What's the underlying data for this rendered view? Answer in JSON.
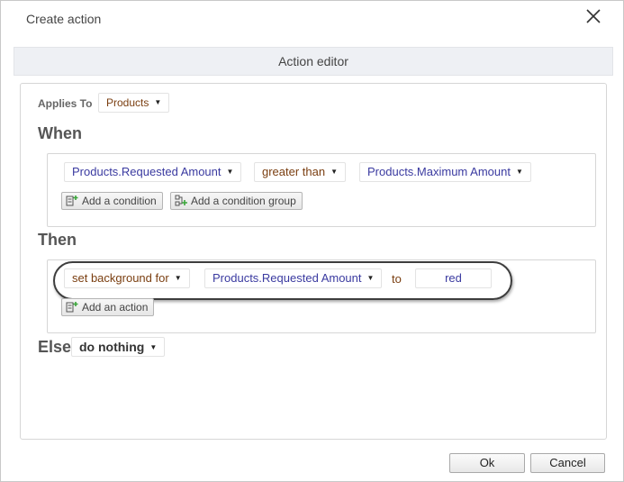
{
  "dialog": {
    "title": "Create action",
    "editor_header": "Action editor"
  },
  "applies_to": {
    "label": "Applies To",
    "value": "Products"
  },
  "when": {
    "heading": "When",
    "condition": {
      "field": "Products.Requested Amount",
      "operator": "greater than",
      "compare_to": "Products.Maximum Amount"
    },
    "add_condition_label": "Add a condition",
    "add_condition_group_label": "Add a condition group"
  },
  "then": {
    "heading": "Then",
    "action": {
      "verb": "set background for",
      "field": "Products.Requested Amount",
      "connector": "to",
      "value": "red"
    },
    "add_action_label": "Add an action"
  },
  "else": {
    "heading": "Else",
    "value": "do nothing"
  },
  "footer": {
    "ok_label": "Ok",
    "cancel_label": "Cancel"
  },
  "icons": {
    "close": "close-icon",
    "add_condition": "add-condition-icon",
    "add_group": "add-condition-group-icon",
    "add_action": "add-action-icon",
    "caret": "caret-down-icon"
  },
  "colors": {
    "field_text": "#3a3aa0",
    "keyword_text": "#7a3e10",
    "header_bg": "#eef0f4",
    "icon_green": "#3aa63a"
  }
}
